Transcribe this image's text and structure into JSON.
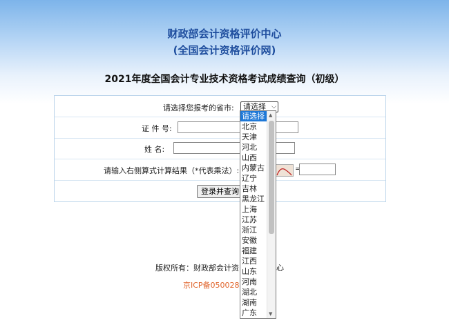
{
  "header": {
    "org_name": "财政部会计资格评价中心",
    "site_name": "(全国会计资格评价网)",
    "page_title": "2021年度全国会计专业技术资格考试成绩查询（初级）"
  },
  "form": {
    "province_label": "请选择您报考的省市:",
    "province_selected": "请选择",
    "id_label": "证 件 号:",
    "id_value": "",
    "name_label": "姓  名:",
    "name_value": "",
    "captcha_label": "请输入右侧算式计算结果（*代表乘法）:",
    "captcha_equals": "=",
    "captcha_value": "",
    "submit_label": "登录并查询"
  },
  "dropdown": {
    "options": [
      "请选择",
      "北京",
      "天津",
      "河北",
      "山西",
      "内蒙古",
      "辽宁",
      "吉林",
      "黑龙江",
      "上海",
      "江苏",
      "浙江",
      "安徽",
      "福建",
      "江西",
      "山东",
      "河南",
      "湖北",
      "湖南",
      "广东"
    ],
    "selected_index": 0
  },
  "footer": {
    "copyright_visible": "版权所有：财政部会计资",
    "copyright_tail": "心",
    "icp_visible": "京ICP备050028"
  }
}
